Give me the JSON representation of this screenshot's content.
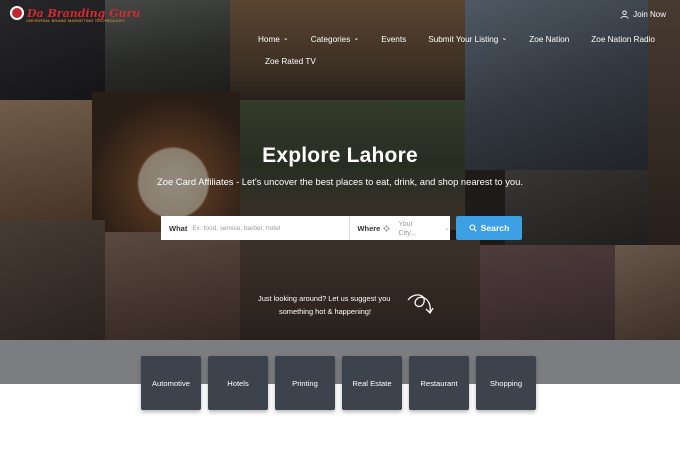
{
  "brand": {
    "name": "Da Branding Guru",
    "tagline": "UNIVERSAL BRAND MARKETING TECHNOLOGY"
  },
  "header": {
    "join_label": "Join Now",
    "nav": [
      {
        "label": "Home",
        "dropdown": true
      },
      {
        "label": "Categories",
        "dropdown": true
      },
      {
        "label": "Events",
        "dropdown": false
      },
      {
        "label": "Submit Your Listing",
        "dropdown": true
      },
      {
        "label": "Zoe Nation",
        "dropdown": false
      },
      {
        "label": "Zoe Nation Radio",
        "dropdown": false
      },
      {
        "label": "Zoe Rated TV",
        "dropdown": false
      }
    ]
  },
  "hero": {
    "title": "Explore Lahore",
    "subtitle": "Zoe Card Affiliates - Let's uncover the best places to eat, drink, and shop nearest to you."
  },
  "search": {
    "what_label": "What",
    "what_placeholder": "Ex: food, service, barber, hotel",
    "where_label": "Where",
    "where_placeholder": "Your City...",
    "button_label": "Search"
  },
  "suggest": {
    "line1": "Just looking around? Let us suggest you",
    "line2": "something hot & happening!"
  },
  "categories": [
    "Automotive",
    "Hotels",
    "Printing",
    "Real Estate",
    "Restaurant",
    "Shopping"
  ],
  "colors": {
    "accent": "#3ea0e4",
    "brand_red": "#d12a2f",
    "category_tile": "#3d434c",
    "band": "#7b7d80"
  }
}
